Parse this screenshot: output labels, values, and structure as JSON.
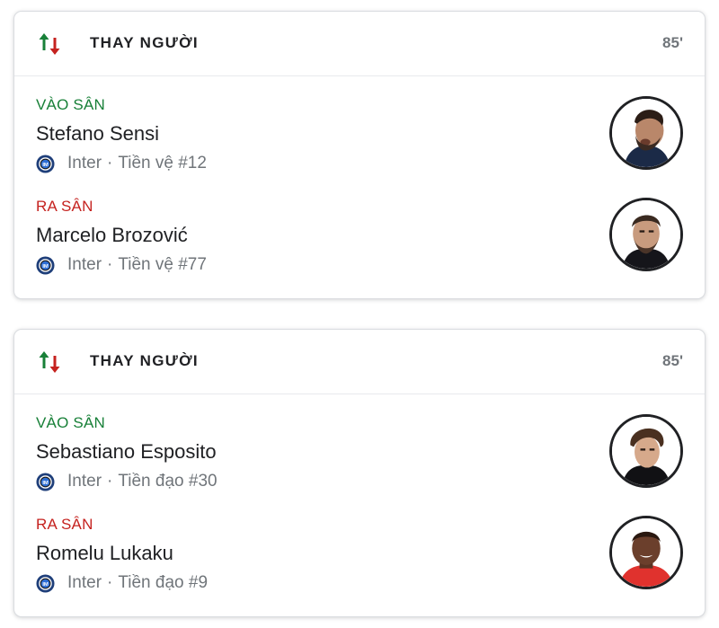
{
  "substitutions": [
    {
      "title": "THAY NGƯỜI",
      "minute": "85'",
      "in": {
        "status": "VÀO SÂN",
        "name": "Stefano Sensi",
        "club": "Inter",
        "separator": "·",
        "position": "Tiền vệ #12"
      },
      "out": {
        "status": "RA SÂN",
        "name": "Marcelo Brozović",
        "club": "Inter",
        "separator": "·",
        "position": "Tiền vệ #77"
      }
    },
    {
      "title": "THAY NGƯỜI",
      "minute": "85'",
      "in": {
        "status": "VÀO SÂN",
        "name": "Sebastiano Esposito",
        "club": "Inter",
        "separator": "·",
        "position": "Tiền đạo #30"
      },
      "out": {
        "status": "RA SÂN",
        "name": "Romelu Lukaku",
        "club": "Inter",
        "separator": "·",
        "position": "Tiền đạo #9"
      }
    }
  ],
  "icons": {
    "substitution": "swap-arrows-icon",
    "club": "inter-logo-icon"
  },
  "colors": {
    "in_status": "#188038",
    "out_status": "#c5221f",
    "arrow_up": "#188038",
    "arrow_down": "#c5221f",
    "secondary_text": "#70757a"
  }
}
